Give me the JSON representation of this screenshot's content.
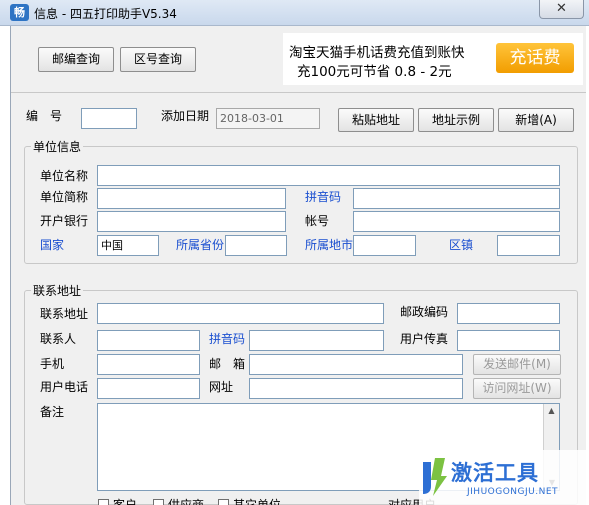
{
  "window": {
    "icon_text": "畅",
    "title": "信息 - 四五打印助手V5.34",
    "close_glyph": "✕"
  },
  "toolbar": {
    "zip_query": "邮编查询",
    "area_code_query": "区号查询"
  },
  "ad": {
    "line1": "淘宝天猫手机话费充值到账快",
    "line2": "充100元可节省 0.8 - 2元",
    "button": "充话费"
  },
  "header": {
    "number_label": "编　号",
    "number_value": "",
    "date_label": "添加日期",
    "date_value": "2018-03-01",
    "paste_button": "粘贴地址",
    "example_button": "地址示例",
    "new_button": "新增(A)"
  },
  "unit": {
    "title": "单位信息",
    "name_label": "单位名称",
    "name_value": "",
    "short_label": "单位简称",
    "short_value": "",
    "pinyin_label": "拼音码",
    "pinyin_value": "",
    "bank_label": "开户银行",
    "bank_value": "",
    "account_label": "帐号",
    "account_value": "",
    "country_label": "国家",
    "country_value": "中国",
    "province_label": "所属省份",
    "province_value": "",
    "city_label": "所属地市",
    "city_value": "",
    "district_label": "区镇",
    "district_value": ""
  },
  "contact": {
    "title": "联系地址",
    "address_label": "联系地址",
    "address_value": "",
    "zip_label": "邮政编码",
    "zip_value": "",
    "person_label": "联系人",
    "person_value": "",
    "pinyin_label": "拼音码",
    "pinyin_value": "",
    "fax_label": "用户传真",
    "fax_value": "",
    "mobile_label": "手机",
    "mobile_value": "",
    "email_label": "邮　箱",
    "email_value": "",
    "send_mail_button": "发送邮件(M)",
    "phone_label": "用户电话",
    "phone_value": "",
    "website_label": "网址",
    "website_value": "",
    "visit_button": "访问网址(W)",
    "remark_label": "备注",
    "remark_value": ""
  },
  "bottom": {
    "cb1": "客户",
    "cb2": "供应商",
    "cb3": "其它单位",
    "trailing": "对应用户…"
  },
  "watermark": {
    "main": "激活工具",
    "sub": "JIHUOGONGJU.NET"
  }
}
